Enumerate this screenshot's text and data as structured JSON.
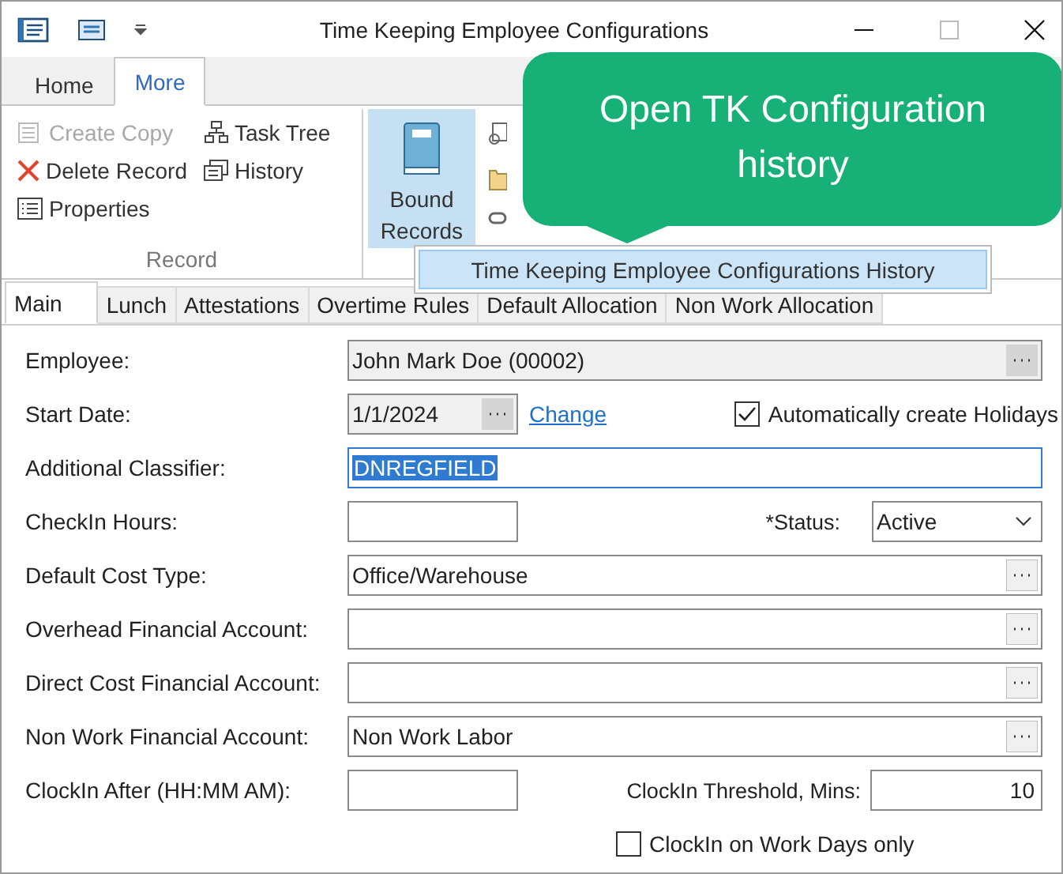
{
  "window": {
    "title": "Time Keeping Employee Configurations"
  },
  "ribbon_tabs": [
    {
      "label": "Home",
      "selected": false
    },
    {
      "label": "More",
      "selected": true
    }
  ],
  "record_group": {
    "label": "Record",
    "items": [
      {
        "label": "Create Copy",
        "disabled": true
      },
      {
        "label": "Delete Record",
        "disabled": false
      },
      {
        "label": "Properties",
        "disabled": false
      },
      {
        "label": "Task Tree",
        "disabled": false
      },
      {
        "label": "History",
        "disabled": false
      }
    ]
  },
  "bound_records": {
    "label": "Bound Records",
    "expanded": true
  },
  "menu": [
    {
      "label": "Time Keeping Employee Configurations History",
      "selected": true
    }
  ],
  "callout": {
    "text": "Open TK Configuration history"
  },
  "form_tabs": [
    {
      "label": "Main",
      "selected": true
    },
    {
      "label": "Lunch",
      "selected": false
    },
    {
      "label": "Attestations",
      "selected": false
    },
    {
      "label": "Overtime Rules",
      "selected": false
    },
    {
      "label": "Default Allocation",
      "selected": false
    },
    {
      "label": "Non Work Allocation",
      "selected": false
    }
  ],
  "form": {
    "employee": {
      "label": "Employee:",
      "value": "John Mark Doe (00002)",
      "disabled": true
    },
    "start_date": {
      "label": "Start Date:",
      "value": "1/1/2024",
      "link": "Change"
    },
    "holidays": {
      "label": "Automatically create Holidays",
      "checked": true
    },
    "classifier": {
      "label": "Additional Classifier:",
      "value": "DNREGFIELD",
      "selected": true
    },
    "checkin_hours": {
      "label": "CheckIn Hours:"
    },
    "status": {
      "label": "*Status:",
      "value": "Active"
    },
    "accounts": [
      {
        "label": "Default Cost Type:",
        "value": "Office/Warehouse"
      },
      {
        "label": "Overhead Financial Account:"
      },
      {
        "label": "Direct Cost Financial Account:"
      },
      {
        "label": "Non Work Financial Account:",
        "value": "Non Work Labor"
      }
    ],
    "clockin_after": {
      "label": "ClockIn After (HH:MM AM):"
    },
    "threshold": {
      "label": "ClockIn Threshold, Mins:",
      "value": "10"
    },
    "work_days": {
      "label": "ClockIn on Work Days only",
      "checked": false
    }
  }
}
